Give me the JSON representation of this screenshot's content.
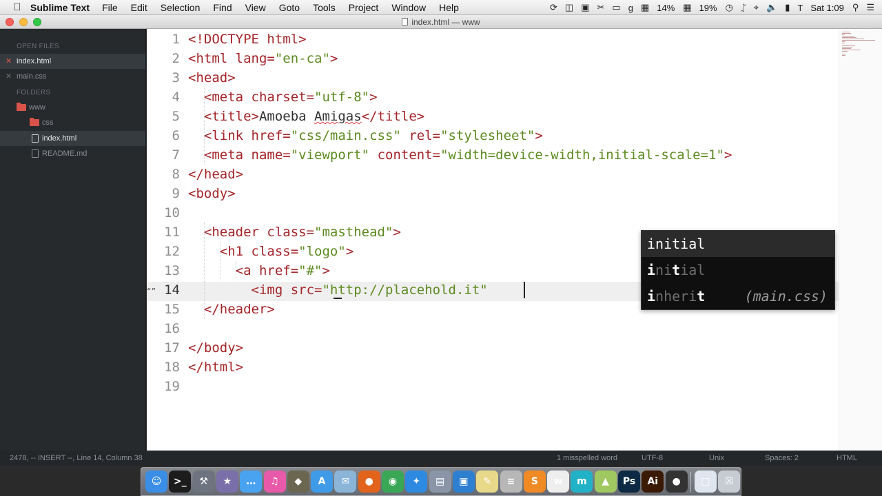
{
  "menubar": {
    "app_name": "Sublime Text",
    "menus": [
      "File",
      "Edit",
      "Selection",
      "Find",
      "View",
      "Goto",
      "Tools",
      "Project",
      "Window",
      "Help"
    ],
    "battery_1": "14%",
    "battery_2": "19%",
    "clock": "Sat 1:09"
  },
  "window": {
    "title": "index.html — www"
  },
  "sidebar": {
    "open_files_heading": "OPEN FILES",
    "open_files": [
      {
        "name": "index.html",
        "active": true
      },
      {
        "name": "main.css",
        "active": false
      }
    ],
    "folders_heading": "FOLDERS",
    "tree": [
      {
        "name": "www",
        "type": "folder"
      },
      {
        "name": "css",
        "type": "folder"
      },
      {
        "name": "index.html",
        "type": "file",
        "active": true
      },
      {
        "name": "README.md",
        "type": "file",
        "active": false
      }
    ]
  },
  "editor": {
    "line_numbers": [
      "1",
      "2",
      "3",
      "4",
      "5",
      "6",
      "7",
      "8",
      "9",
      "10",
      "11",
      "12",
      "13",
      "14",
      "15",
      "16",
      "17",
      "18",
      "19"
    ],
    "current_line": "14",
    "gutter_mark": "“”",
    "lines": [
      [
        {
          "t": "tg",
          "v": "<!DOCTYPE html>"
        }
      ],
      [
        {
          "t": "tg",
          "v": "<html "
        },
        {
          "t": "at",
          "v": "lang="
        },
        {
          "t": "st",
          "v": "\"en-ca\""
        },
        {
          "t": "tg",
          "v": ">"
        }
      ],
      [
        {
          "t": "tg",
          "v": "<head>"
        }
      ],
      [
        {
          "t": "tx",
          "v": "  "
        },
        {
          "t": "tg",
          "v": "<meta "
        },
        {
          "t": "at",
          "v": "charset="
        },
        {
          "t": "st",
          "v": "\"utf-8\""
        },
        {
          "t": "tg",
          "v": ">"
        }
      ],
      [
        {
          "t": "tx",
          "v": "  "
        },
        {
          "t": "tg",
          "v": "<title>"
        },
        {
          "t": "tx",
          "v": "Amoeba "
        },
        {
          "t": "spell",
          "v": "Amigas"
        },
        {
          "t": "tg",
          "v": "</title>"
        }
      ],
      [
        {
          "t": "tx",
          "v": "  "
        },
        {
          "t": "tg",
          "v": "<link "
        },
        {
          "t": "at",
          "v": "href="
        },
        {
          "t": "st",
          "v": "\"css/main.css\""
        },
        {
          "t": "at",
          "v": " rel="
        },
        {
          "t": "st",
          "v": "\"stylesheet\""
        },
        {
          "t": "tg",
          "v": ">"
        }
      ],
      [
        {
          "t": "tx",
          "v": "  "
        },
        {
          "t": "tg",
          "v": "<meta "
        },
        {
          "t": "at",
          "v": "name="
        },
        {
          "t": "st",
          "v": "\"viewport\""
        },
        {
          "t": "at",
          "v": " content="
        },
        {
          "t": "st",
          "v": "\"width=device-width,initial-scale=1\""
        },
        {
          "t": "tg",
          "v": ">"
        }
      ],
      [
        {
          "t": "tg",
          "v": "</head>"
        }
      ],
      [
        {
          "t": "tg",
          "v": "<body>"
        }
      ],
      [],
      [
        {
          "t": "tx",
          "v": "  "
        },
        {
          "t": "tg",
          "v": "<header "
        },
        {
          "t": "at",
          "v": "class="
        },
        {
          "t": "st",
          "v": "\"masthead\""
        },
        {
          "t": "tg",
          "v": ">"
        }
      ],
      [
        {
          "t": "tx",
          "v": "    "
        },
        {
          "t": "tg",
          "v": "<h1 "
        },
        {
          "t": "at",
          "v": "class="
        },
        {
          "t": "st",
          "v": "\"logo\""
        },
        {
          "t": "tg",
          "v": ">"
        }
      ],
      [
        {
          "t": "tx",
          "v": "      "
        },
        {
          "t": "tg",
          "v": "<a "
        },
        {
          "t": "at",
          "v": "href="
        },
        {
          "t": "st",
          "v": "\"#\""
        },
        {
          "t": "tg",
          "v": ">"
        }
      ],
      [
        {
          "t": "tx",
          "v": "        "
        },
        {
          "t": "tg",
          "v": "<img "
        },
        {
          "t": "at",
          "v": "src="
        },
        {
          "t": "st",
          "v": "\"http://placehold.it\""
        }
      ],
      [
        {
          "t": "tx",
          "v": "  "
        },
        {
          "t": "tg",
          "v": "</header>"
        }
      ],
      [],
      [
        {
          "t": "tg",
          "v": "</body>"
        }
      ],
      [
        {
          "t": "tg",
          "v": "</html>"
        }
      ],
      []
    ]
  },
  "autocomplete": {
    "items": [
      {
        "parts": [
          {
            "b": false,
            "v": "initial"
          }
        ],
        "hint": "",
        "selected": true
      },
      {
        "parts": [
          {
            "b": true,
            "v": "i"
          },
          {
            "b": false,
            "v": "ni"
          },
          {
            "b": true,
            "v": "t"
          },
          {
            "b": false,
            "v": "ial"
          }
        ],
        "hint": "",
        "selected": false
      },
      {
        "parts": [
          {
            "b": true,
            "v": "i"
          },
          {
            "b": false,
            "v": "nheri"
          },
          {
            "b": true,
            "v": "t"
          }
        ],
        "hint": "(main.css)",
        "selected": false
      }
    ]
  },
  "statusbar": {
    "left": "2478, -- INSERT --, Line 14, Column 38",
    "spelling": "1 misspelled word",
    "encoding": "UTF-8",
    "line_endings": "Unix",
    "indent": "Spaces: 2",
    "syntax": "HTML"
  },
  "dock": {
    "icons": [
      {
        "name": "finder-icon",
        "color": "#3a8ee6",
        "glyph": "☺"
      },
      {
        "name": "terminal-icon",
        "color": "#1c1c1c",
        "glyph": ">_"
      },
      {
        "name": "utility-icon",
        "color": "#6d7480",
        "glyph": "⚒"
      },
      {
        "name": "gimp-icon",
        "color": "#7a6fa8",
        "glyph": "★"
      },
      {
        "name": "messages-icon",
        "color": "#4aa3f0",
        "glyph": "…"
      },
      {
        "name": "itunes-icon",
        "color": "#e85aa9",
        "glyph": "♫"
      },
      {
        "name": "shield-app-icon",
        "color": "#6b6650",
        "glyph": "◆"
      },
      {
        "name": "app-store-icon",
        "color": "#3f9ae8",
        "glyph": "A"
      },
      {
        "name": "preview-icon",
        "color": "#8ab4d8",
        "glyph": "✉"
      },
      {
        "name": "firefox-icon",
        "color": "#e2631c",
        "glyph": "●"
      },
      {
        "name": "chrome-icon",
        "color": "#3aa757",
        "glyph": "◉"
      },
      {
        "name": "safari-icon",
        "color": "#2d8ae0",
        "glyph": "✦"
      },
      {
        "name": "image-capture-icon",
        "color": "#8a96a8",
        "glyph": "▤"
      },
      {
        "name": "screen-sharing-icon",
        "color": "#2f7fd0",
        "glyph": "▣"
      },
      {
        "name": "notes-icon",
        "color": "#e8d98a",
        "glyph": "✎"
      },
      {
        "name": "text-editor-icon",
        "color": "#b7b7b7",
        "glyph": "≡"
      },
      {
        "name": "sublime-text-icon",
        "color": "#f08a24",
        "glyph": "S"
      },
      {
        "name": "writer-icon",
        "color": "#eeeeee",
        "glyph": "w"
      },
      {
        "name": "mindnode-icon",
        "color": "#22b2c8",
        "glyph": "m"
      },
      {
        "name": "prism-icon",
        "color": "#a0c860",
        "glyph": "▲"
      },
      {
        "name": "photoshop-icon",
        "color": "#0c2a44",
        "glyph": "Ps"
      },
      {
        "name": "illustrator-icon",
        "color": "#3a1a05",
        "glyph": "Ai"
      },
      {
        "name": "github-icon",
        "color": "#333333",
        "glyph": "●"
      },
      {
        "name": "documents-icon",
        "color": "#dfe6ef",
        "glyph": "□"
      },
      {
        "name": "trash-icon",
        "color": "#c7ccd2",
        "glyph": "☒"
      }
    ]
  },
  "colors": {
    "tag": "#a42428",
    "string": "#5c8a1f",
    "sidebar_bg": "#272a2d",
    "popup_bg": "#0f0f0f"
  }
}
